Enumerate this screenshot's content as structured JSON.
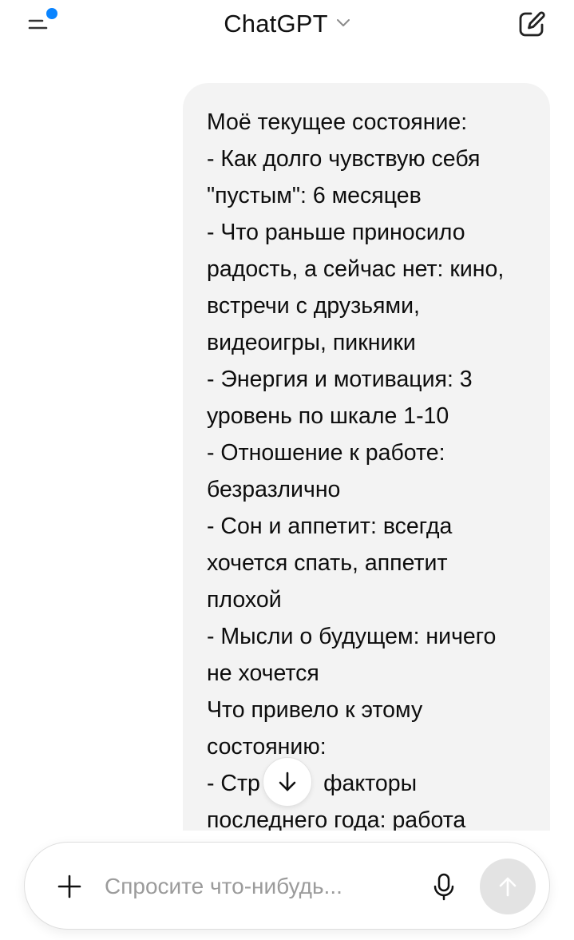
{
  "header": {
    "title": "ChatGPT",
    "menu_icon": "menu-lines-icon",
    "notification_dot_color": "#0a84ff",
    "new_chat_icon": "new-chat-edit-icon"
  },
  "conversation": {
    "user_message_lines": [
      "Моё текущее состояние:",
      "- Как долго чувствую себя",
      "\"пустым\": 6 месяцев",
      "- Что раньше приносило",
      "радость, а сейчас нет: кино,",
      "встречи с друзьями,",
      "видеоигры, пикники",
      "- Энергия и мотивация: 3",
      "уровень по шкале 1-10",
      "- Отношение к работе:",
      "безразлично",
      "- Сон и аппетит: всегда",
      "хочется спать, аппетит",
      "плохой",
      "- Мысли о будущем: ничего",
      "не хочется",
      "Что привело к этому",
      "состоянию:",
      "- Стр          факторы",
      "последнего года: работа"
    ]
  },
  "composer": {
    "placeholder": "Спросите что-нибудь...",
    "value": ""
  },
  "colors": {
    "bubble_bg": "#f3f3f3",
    "send_disabled_bg": "#e3e3e3",
    "accent_dot": "#0a84ff"
  }
}
